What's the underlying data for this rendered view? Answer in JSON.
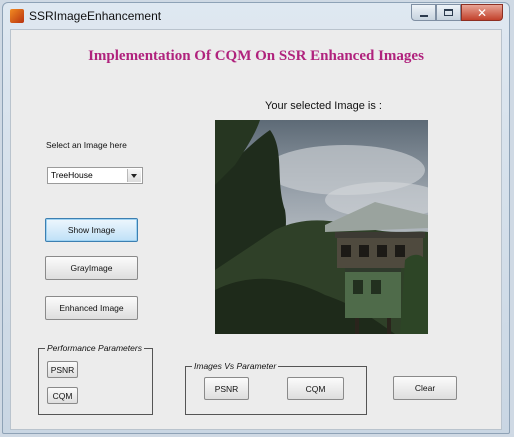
{
  "window": {
    "title": "SSRImageEnhancement",
    "controls": {
      "minimize": "minimize",
      "maximize": "maximize",
      "close": "✕"
    }
  },
  "main_title": "Implementation Of CQM On SSR Enhanced Images",
  "image_panel": {
    "caption": "Your selected Image is :"
  },
  "image_select": {
    "label": "Select an Image here",
    "selected": "TreeHouse"
  },
  "actions": {
    "show_image": "Show Image",
    "gray_image": "GrayImage",
    "enhanced_image": "Enhanced Image"
  },
  "performance_group": {
    "title": "Performance Parameters",
    "psnr": "PSNR",
    "cqm": "CQM"
  },
  "images_vs_parameter_group": {
    "title": "Images Vs Parameter",
    "psnr": "PSNR",
    "cqm": "CQM"
  },
  "clear": "Clear",
  "colors": {
    "title_magenta": "#b0227d",
    "selected_button": "#bfe1f7"
  }
}
